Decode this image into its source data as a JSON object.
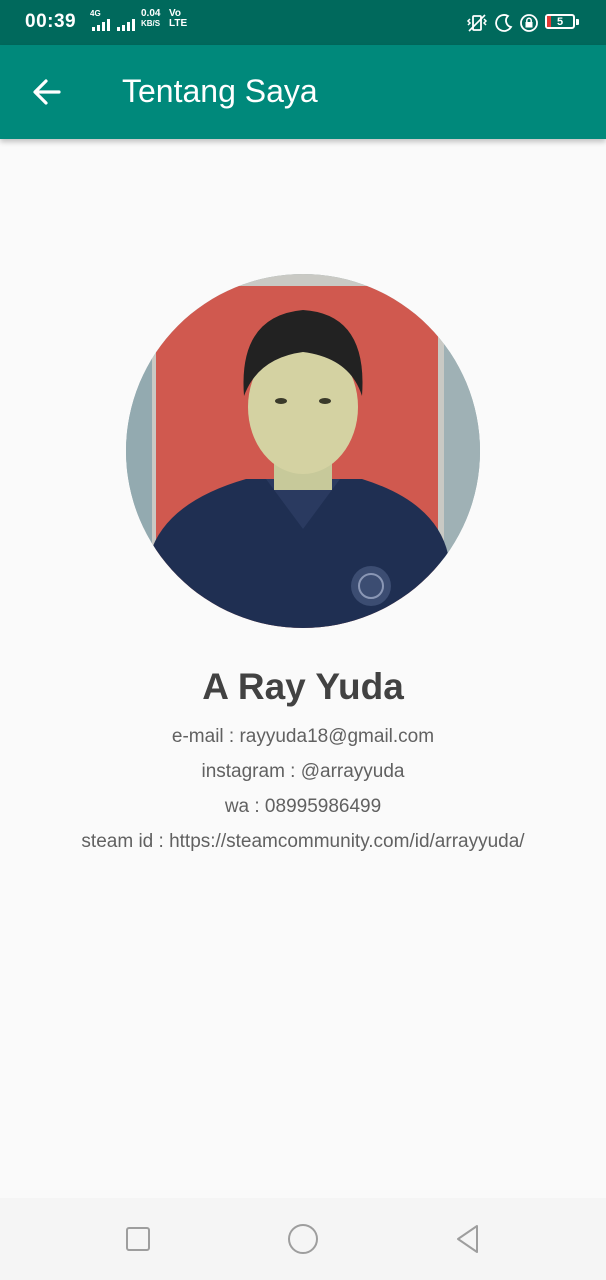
{
  "status_bar": {
    "time": "00:39",
    "network_type": "4G",
    "data_speed_value": "0.04",
    "data_speed_unit": "KB/S",
    "volte_top": "Vo",
    "volte_bottom": "LTE",
    "battery_level": "5",
    "icons": [
      "signal-icon",
      "signal-icon",
      "vibrate-icon",
      "moon-icon",
      "lock-rotation-icon",
      "battery-icon"
    ]
  },
  "app_bar": {
    "title": "Tentang Saya",
    "back_icon": "arrow-back-icon"
  },
  "profile": {
    "name": "A Ray Yuda",
    "email_line": "e-mail : rayyuda18@gmail.com",
    "instagram_line": "instagram : @arrayyuda",
    "wa_line": "wa : 08995986499",
    "steam_line": "steam id : https://steamcommunity.com/id/arrayyuda/"
  },
  "nav_bar": {
    "icons": [
      "recents-square-icon",
      "home-circle-icon",
      "back-triangle-icon"
    ]
  },
  "colors": {
    "status_bar": "#00695c",
    "app_bar": "#00897b",
    "background": "#fafafa",
    "name_text": "#424242",
    "info_text": "#616161"
  }
}
